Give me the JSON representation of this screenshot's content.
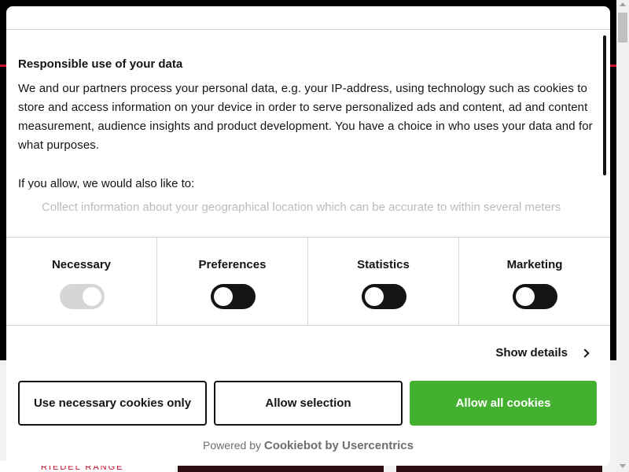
{
  "background": {
    "card_text": "RIEDEL RANGE"
  },
  "dialog": {
    "title": "Responsible use of your data",
    "description": "We and our partners process your personal data, e.g. your IP-address, using technology such as cookies to store and access information on your device in order to serve personalized ads and content, ad and content measurement, audience insights and product development. You have a choice in who uses your data and for what purposes.",
    "allow_intro": "If you allow, we would also like to:",
    "purposes": [
      "Collect information about your geographical location which can be accurate to within several meters"
    ]
  },
  "consent": {
    "categories": [
      {
        "label": "Necessary",
        "checked": true,
        "disabled": true
      },
      {
        "label": "Preferences",
        "checked": false,
        "disabled": false
      },
      {
        "label": "Statistics",
        "checked": false,
        "disabled": false
      },
      {
        "label": "Marketing",
        "checked": false,
        "disabled": false
      }
    ]
  },
  "details": {
    "label": "Show details"
  },
  "buttons": {
    "necessary_only": "Use necessary cookies only",
    "allow_selection": "Allow selection",
    "allow_all": "Allow all cookies"
  },
  "footer": {
    "powered_prefix": "Powered by",
    "brand": "Cookiebot by Usercentrics"
  },
  "colors": {
    "accent_green": "#44b02f",
    "brand_red": "#c8102e",
    "text": "#141414"
  },
  "icons": {
    "details_chevron": "chevron-right-icon"
  }
}
